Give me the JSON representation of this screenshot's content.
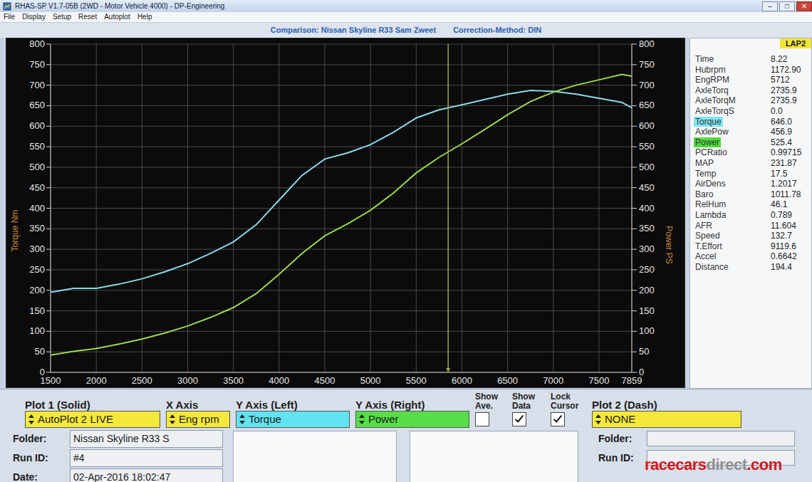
{
  "window": {
    "title": "RHAS-SP V1.7-05B (2WD - Motor Vehicle 4000) - DP-Engineering",
    "controls": [
      "–",
      "□",
      "✕"
    ]
  },
  "menu": [
    "File",
    "Display",
    "Setup",
    "Reset",
    "Autoplot",
    "Help"
  ],
  "comparison": {
    "run": "Comparison: Nissan Skyline R33 Sam Zweet",
    "correction": "Correction-Method: DIN"
  },
  "chart": {
    "x_axis": {
      "ticks": [
        "1500",
        "2000",
        "2500",
        "3000",
        "3500",
        "4000",
        "4500",
        "5000",
        "5500",
        "6000",
        "6500",
        "7000",
        "7500",
        "7859"
      ]
    },
    "left_axis": {
      "title": "Torque Nm",
      "ticks": [
        "0",
        "50",
        "100",
        "150",
        "200",
        "250",
        "300",
        "350",
        "400",
        "450",
        "500",
        "550",
        "600",
        "650",
        "700",
        "750",
        "800"
      ]
    },
    "right_axis": {
      "title": "Power PS",
      "ticks": [
        "0",
        "50",
        "100",
        "150",
        "200",
        "250",
        "300",
        "350",
        "400",
        "450",
        "500",
        "550",
        "600",
        "650",
        "700",
        "750",
        "800"
      ]
    },
    "rpm": [
      1500,
      1750,
      2000,
      2250,
      2500,
      2750,
      3000,
      3250,
      3500,
      3750,
      4000,
      4250,
      4500,
      4750,
      5000,
      5250,
      5500,
      5750,
      6000,
      6250,
      6500,
      6750,
      7000,
      7250,
      7500,
      7750,
      7859
    ],
    "series": [
      {
        "axis": "left",
        "color": "#8ad8e8",
        "values": [
          195,
          205,
          205,
          215,
          228,
          245,
          265,
          290,
          318,
          360,
          420,
          480,
          520,
          535,
          555,
          585,
          620,
          640,
          652,
          665,
          678,
          687,
          685,
          678,
          668,
          658,
          645
        ]
      },
      {
        "axis": "right",
        "color": "#9ad84c",
        "values": [
          42,
          51,
          58,
          69,
          81,
          96,
          113,
          134,
          158,
          192,
          239,
          290,
          333,
          362,
          395,
          437,
          486,
          524,
          557,
          592,
          628,
          660,
          683,
          700,
          713,
          726,
          722
        ]
      }
    ],
    "cursor": {
      "rpm": 5850
    }
  },
  "readout": {
    "header": "LAP2",
    "rows": [
      {
        "label": "Time",
        "value": "8.22"
      },
      {
        "label": "Hubrpm",
        "value": "1172.90"
      },
      {
        "label": "EngRPM",
        "value": "5712"
      },
      {
        "label": "AxleTorq",
        "value": "2735.9"
      },
      {
        "label": "AxleTorqM",
        "value": "2735.9"
      },
      {
        "label": "AxleTorqS",
        "value": "0.0"
      },
      {
        "label": "Torque",
        "value": "646.0",
        "color": "#7de6f2"
      },
      {
        "label": "AxlePow",
        "value": "456.9"
      },
      {
        "label": "Power",
        "value": "525.4",
        "color": "#4fdc3c"
      },
      {
        "label": "PCRatio",
        "value": "0.99715"
      },
      {
        "label": "MAP",
        "value": "231.87"
      },
      {
        "label": "Temp",
        "value": "17.5"
      },
      {
        "label": "AirDens",
        "value": "1.2017"
      },
      {
        "label": "Baro",
        "value": "1011.78"
      },
      {
        "label": "RelHum",
        "value": "46.1"
      },
      {
        "label": "Lambda",
        "value": "0.789"
      },
      {
        "label": "AFR",
        "value": "11.604"
      },
      {
        "label": "Speed",
        "value": "132.7"
      },
      {
        "label": "T.Effort",
        "value": "9119.6"
      },
      {
        "label": "Accel",
        "value": "0.6642"
      },
      {
        "label": "Distance",
        "value": "194.4"
      }
    ]
  },
  "plot_panel": {
    "selects": [
      {
        "label": "Plot 1 (Solid)",
        "value": "AutoPlot 2 LIVE",
        "color": "#f5e83c"
      },
      {
        "label": "X Axis",
        "value": "Eng rpm",
        "color": "#f5e83c"
      },
      {
        "label": "Y Axis (Left)",
        "value": "Torque",
        "color": "#62e4f0"
      },
      {
        "label": "Y Axis (Right)",
        "value": "Power",
        "color": "#56dd48"
      }
    ],
    "checks": [
      {
        "label": "Show Ave.",
        "checked": false
      },
      {
        "label": "Show Data",
        "checked": true
      },
      {
        "label": "Lock Cursor",
        "checked": true
      }
    ],
    "plot2": {
      "label": "Plot 2 (Dash)",
      "value": "NONE",
      "color": "#f5e83c"
    },
    "fields1": [
      {
        "label": "Folder:",
        "value": "Nissan Skyline R33 S"
      },
      {
        "label": "Run ID:",
        "value": "#4"
      },
      {
        "label": "Date:",
        "value": "02-Apr-2016 18:02:47"
      }
    ],
    "fields2": [
      {
        "label": "Folder:",
        "value": ""
      },
      {
        "label": "Run ID:",
        "value": ""
      }
    ]
  },
  "watermark": [
    {
      "text": "racecars",
      "color": "#d3161c"
    },
    {
      "text": "direct",
      "color": "#8f8f8f"
    },
    {
      "text": ".com",
      "color": "#d3161c"
    }
  ]
}
